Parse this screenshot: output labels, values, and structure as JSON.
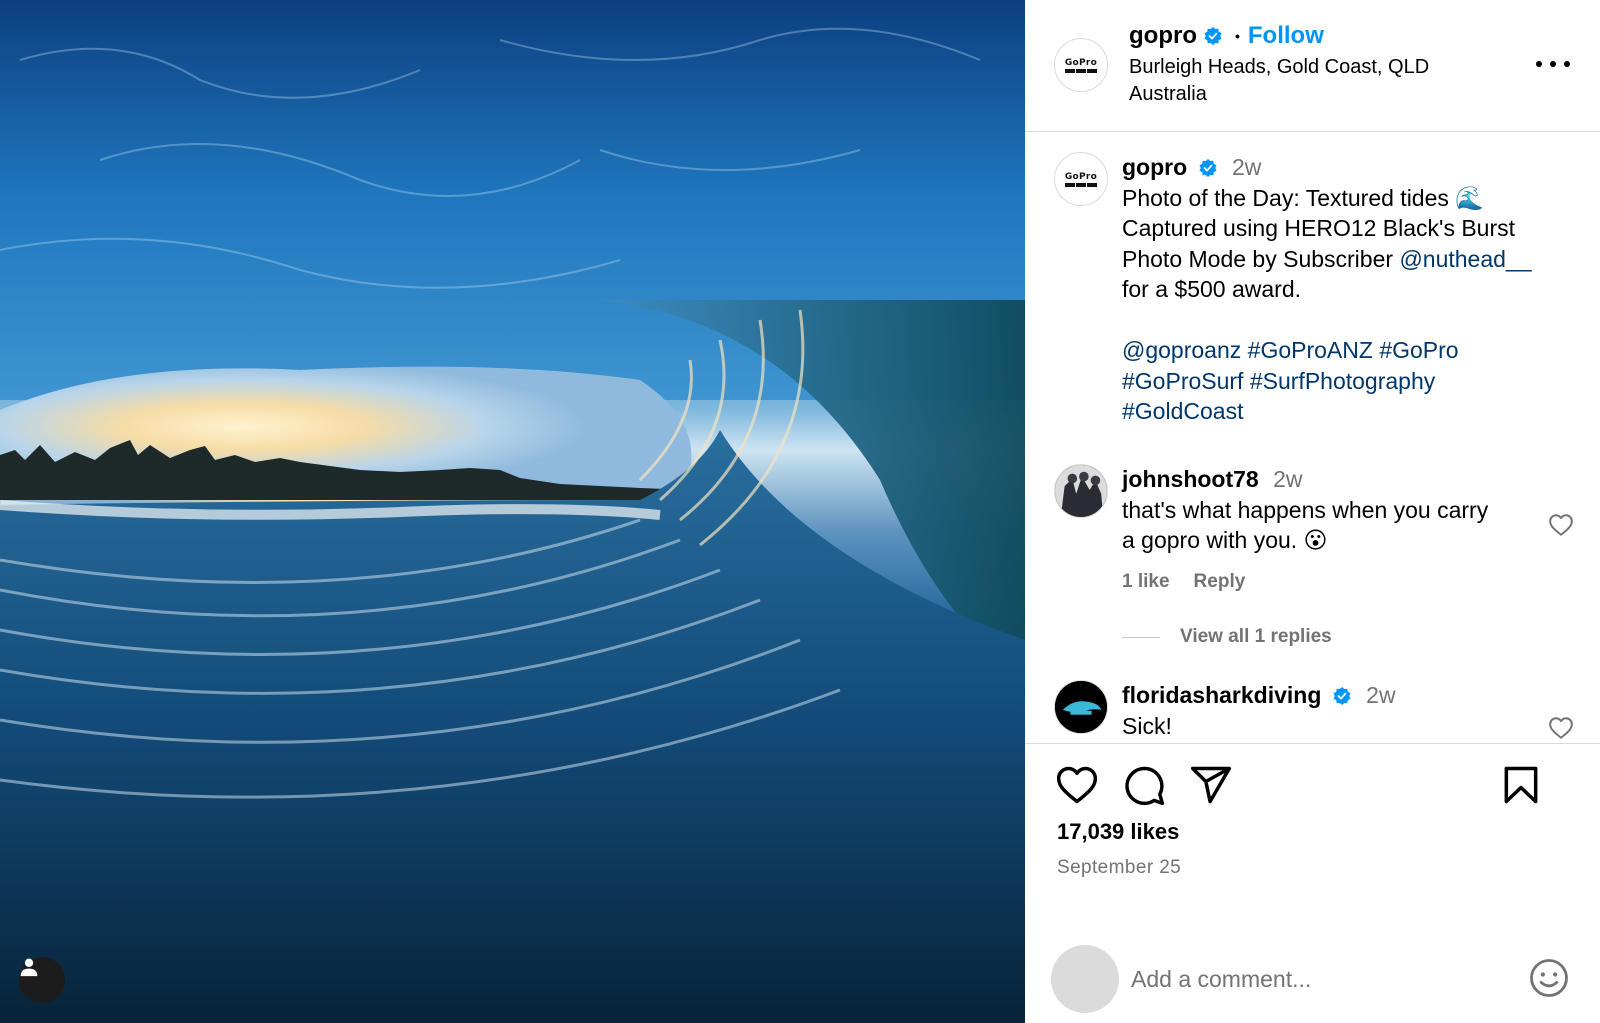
{
  "post": {
    "author": "gopro",
    "follow_label": "Follow",
    "location": "Burleigh Heads, Gold Coast, QLD Australia",
    "avatar_logo_text": "GoPro"
  },
  "caption": {
    "user": "gopro",
    "time": "2w",
    "line1": "Photo of the Day: Textured tides 🌊",
    "line2": "Captured using HERO12 Black's Burst",
    "line3_prefix": "Photo Mode by Subscriber ",
    "mention": "@nuthead__",
    "line4": "for a $500 award.",
    "tags": [
      "@goproanz",
      "#GoProANZ",
      "#GoPro",
      "#GoProSurf",
      "#SurfPhotography",
      "#GoldCoast"
    ]
  },
  "comments": [
    {
      "user": "johnshoot78",
      "time": "2w",
      "line1": "that's what happens when you carry",
      "line2": "a gopro with you. 😮",
      "likes": "1 like",
      "reply": "Reply",
      "view_replies": "View all 1 replies"
    },
    {
      "user": "floridasharkdiving",
      "time": "2w",
      "text": "Sick!"
    }
  ],
  "stats": {
    "likes": "17,039 likes",
    "date": "September 25"
  },
  "add_comment": {
    "placeholder": "Add a comment..."
  },
  "icons": [
    "user-tag-icon",
    "verified-icon",
    "more-icon",
    "heart-icon",
    "comment-icon",
    "share-icon",
    "bookmark-icon",
    "emoji-icon"
  ],
  "colors": {
    "follow": "#0095f6",
    "verified": "#0095f6",
    "link": "#00376b",
    "secondary_text": "#737373"
  }
}
